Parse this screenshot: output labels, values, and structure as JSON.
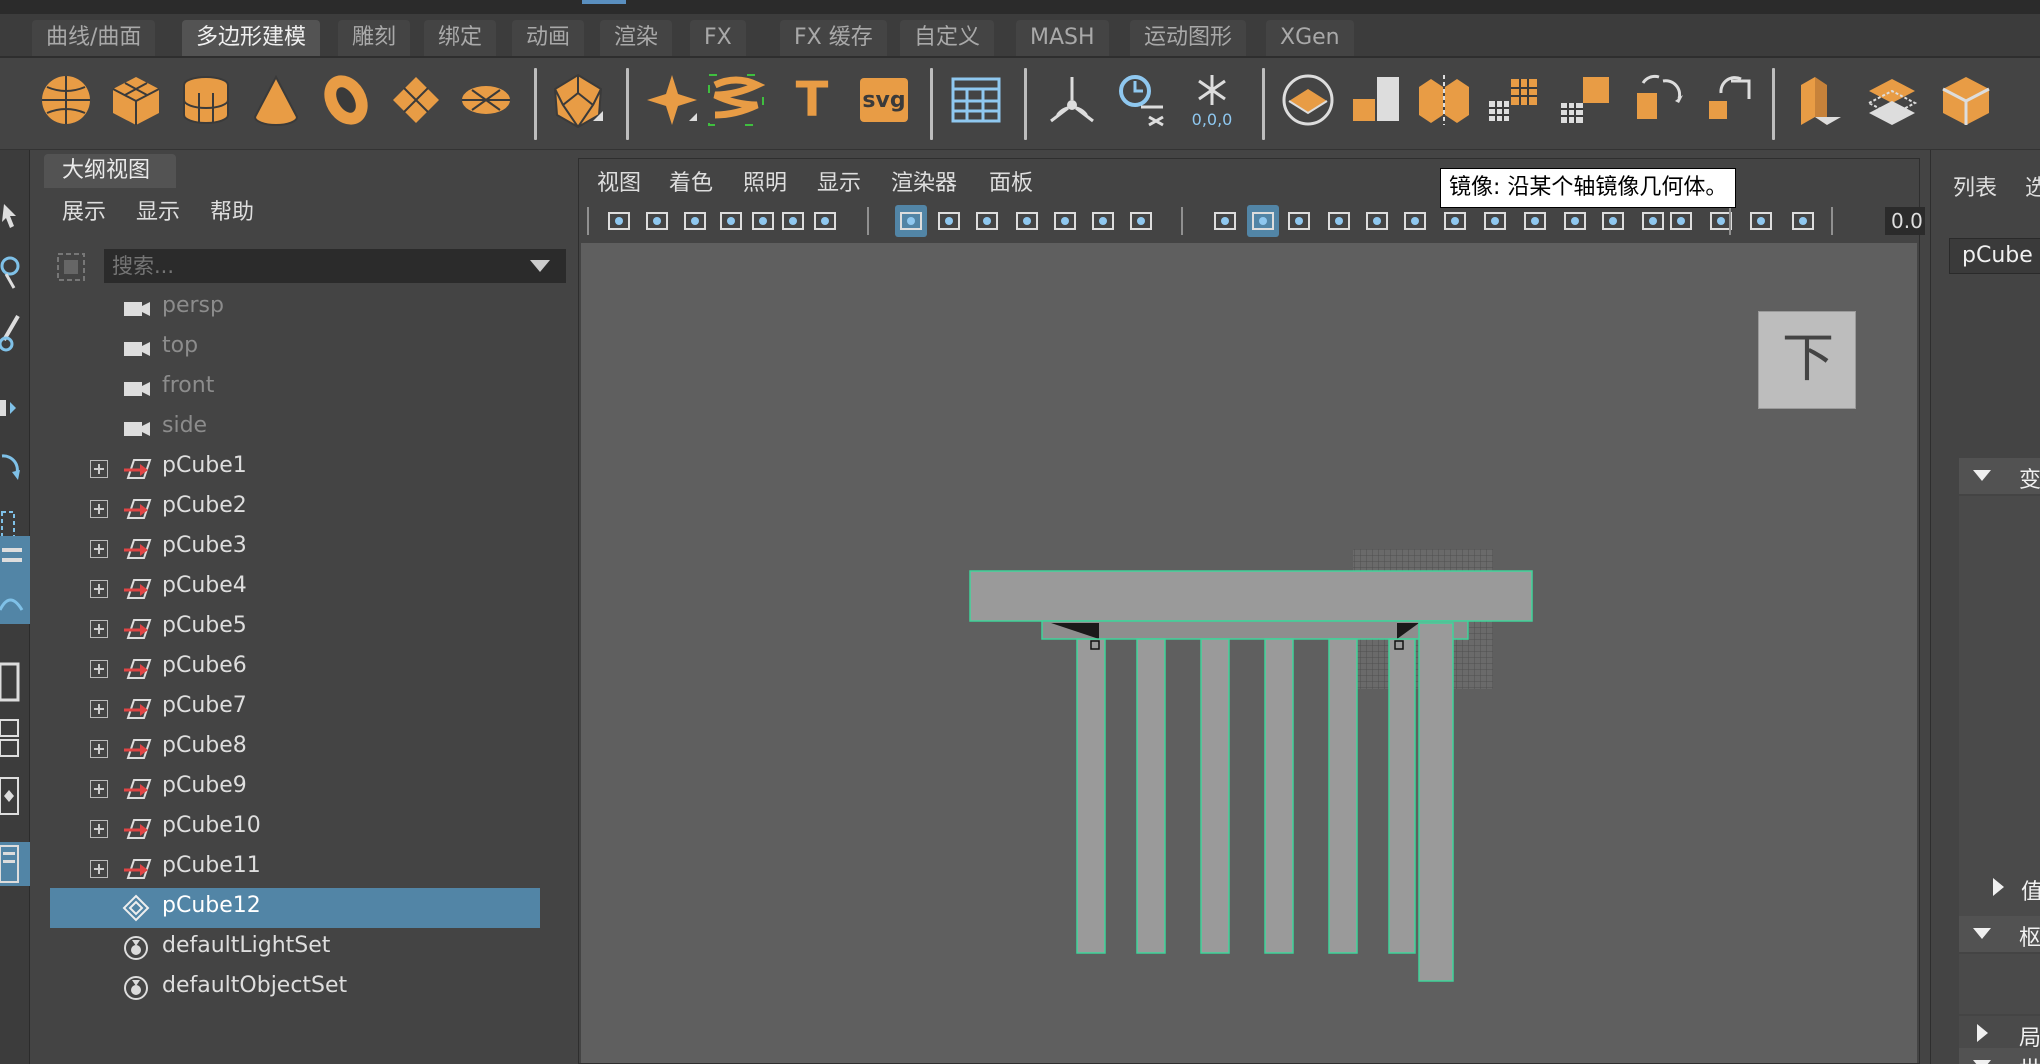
{
  "colors": {
    "accent": "#e89c45",
    "selection": "#5285a6",
    "wire": "#3fd49a",
    "viewport_bg": "#5f5f5f"
  },
  "tabs": [
    "曲线/曲面",
    "多边形建模",
    "雕刻",
    "绑定",
    "动画",
    "渲染",
    "FX",
    "FX 缓存",
    "自定义",
    "MASH",
    "运动图形",
    "XGen"
  ],
  "active_tab": "多边形建模",
  "shelf": {
    "icons": [
      "poly-sphere-icon",
      "poly-cube-icon",
      "poly-cylinder-icon",
      "poly-cone-icon",
      "poly-torus-icon",
      "poly-plane-icon",
      "poly-disc-icon",
      "platonic-solid-icon",
      "super-shape-icon",
      "sweep-mesh-icon",
      "type-icon",
      "svg-icon",
      "uv-editor-icon",
      "center-pivot-icon",
      "delete-history-icon",
      "freeze-transform-icon",
      "make-live-icon",
      "combine-icon",
      "separate-icon",
      "smooth-icon",
      "extract-icon",
      "mirror-icon",
      "boolean-icon",
      "bevel-icon",
      "bridge-icon",
      "extrude-icon"
    ],
    "svg_label": "svg",
    "type_label": "T",
    "freeze_label": "0,0,0"
  },
  "outliner": {
    "tab_label": "大纲视图",
    "menu": [
      "展示",
      "显示",
      "帮助"
    ],
    "search_placeholder": "搜索...",
    "items": [
      {
        "label": "persp",
        "kind": "camera"
      },
      {
        "label": "top",
        "kind": "camera"
      },
      {
        "label": "front",
        "kind": "camera"
      },
      {
        "label": "side",
        "kind": "camera"
      },
      {
        "label": "pCube1",
        "kind": "mesh"
      },
      {
        "label": "pCube2",
        "kind": "mesh"
      },
      {
        "label": "pCube3",
        "kind": "mesh"
      },
      {
        "label": "pCube4",
        "kind": "mesh"
      },
      {
        "label": "pCube5",
        "kind": "mesh"
      },
      {
        "label": "pCube6",
        "kind": "mesh"
      },
      {
        "label": "pCube7",
        "kind": "mesh"
      },
      {
        "label": "pCube8",
        "kind": "mesh"
      },
      {
        "label": "pCube9",
        "kind": "mesh"
      },
      {
        "label": "pCube10",
        "kind": "mesh"
      },
      {
        "label": "pCube11",
        "kind": "mesh"
      },
      {
        "label": "pCube12",
        "kind": "group",
        "selected": true
      },
      {
        "label": "defaultLightSet",
        "kind": "set"
      },
      {
        "label": "defaultObjectSet",
        "kind": "set"
      }
    ]
  },
  "viewport": {
    "menu": [
      "视图",
      "着色",
      "照明",
      "显示",
      "渲染器",
      "面板"
    ],
    "readout": "0.0",
    "view_cube_label": "下"
  },
  "tooltip": "镜像: 沿某个轴镜像几何体。",
  "attribute_editor": {
    "tab_list": "列表",
    "tab_select": "选",
    "node_name": "pCube",
    "sections": [
      "变",
      "值",
      "枢",
      "局",
      "世"
    ]
  }
}
